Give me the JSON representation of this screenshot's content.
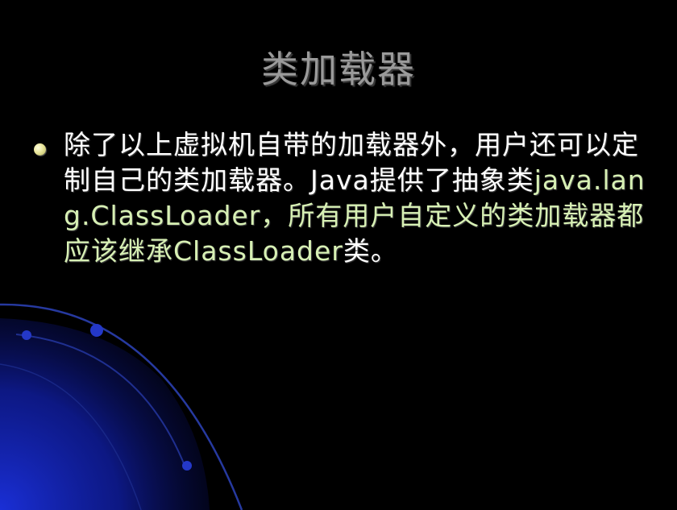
{
  "slide": {
    "title": "类加载器",
    "bullet": {
      "segments": [
        "除了以上虚拟机自带的加载器外，用户还可以定制自己的类加载器。Java提供了抽象类",
        "java.lang.ClassLoader，所有用户自定义的类加载器都应该继承ClassLoader",
        "类。"
      ]
    }
  },
  "colors": {
    "background": "#000000",
    "title": "#9a9a9a",
    "text": "#ffffff",
    "highlight_text": "#d7f0b4",
    "bullet": "#e9e69a",
    "decor_blue": "#1a2fd6"
  }
}
